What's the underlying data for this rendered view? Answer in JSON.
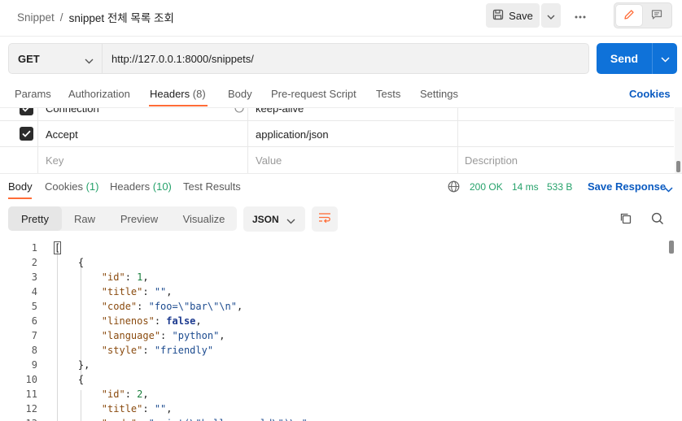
{
  "breadcrumb": {
    "parent": "Snippet",
    "separator": "/",
    "current": "snippet 전체 목록 조회"
  },
  "toolbar": {
    "save_label": "Save"
  },
  "request": {
    "method": "GET",
    "url": "http://127.0.0.1:8000/snippets/",
    "send_label": "Send"
  },
  "request_tabs": {
    "params": "Params",
    "authorization": "Authorization",
    "headers": "Headers",
    "headers_count": "(8)",
    "body": "Body",
    "prerequest": "Pre-request Script",
    "tests": "Tests",
    "settings": "Settings",
    "cookies": "Cookies"
  },
  "headers_table": {
    "rows": [
      {
        "key": "Connection",
        "value": "keep-alive",
        "checked": true
      },
      {
        "key": "Accept",
        "value": "application/json",
        "checked": true
      }
    ],
    "placeholders": {
      "key": "Key",
      "value": "Value",
      "description": "Description"
    }
  },
  "response_tabs": {
    "body": "Body",
    "cookies": "Cookies",
    "cookies_count": "(1)",
    "headers": "Headers",
    "headers_count": "(10)",
    "test_results": "Test Results"
  },
  "response_status": {
    "status": "200 OK",
    "time": "14 ms",
    "size": "533 B",
    "save_response": "Save Response"
  },
  "view_modes": {
    "pretty": "Pretty",
    "raw": "Raw",
    "preview": "Preview",
    "visualize": "Visualize",
    "active": "Pretty"
  },
  "format": "JSON",
  "code_lines": [
    {
      "n": "1",
      "parts": [
        [
          "p",
          "["
        ]
      ]
    },
    {
      "n": "2",
      "parts": [
        [
          "p",
          "    {"
        ]
      ]
    },
    {
      "n": "3",
      "parts": [
        [
          "p",
          "        "
        ],
        [
          "k",
          "\"id\""
        ],
        [
          "p",
          ": "
        ],
        [
          "n",
          "1"
        ],
        [
          "p",
          ","
        ]
      ]
    },
    {
      "n": "4",
      "parts": [
        [
          "p",
          "        "
        ],
        [
          "k",
          "\"title\""
        ],
        [
          "p",
          ": "
        ],
        [
          "s",
          "\"\""
        ],
        [
          "p",
          ","
        ]
      ]
    },
    {
      "n": "5",
      "parts": [
        [
          "p",
          "        "
        ],
        [
          "k",
          "\"code\""
        ],
        [
          "p",
          ": "
        ],
        [
          "s",
          "\"foo=\\\"bar\\\"\\n\""
        ],
        [
          "p",
          ","
        ]
      ]
    },
    {
      "n": "6",
      "parts": [
        [
          "p",
          "        "
        ],
        [
          "k",
          "\"linenos\""
        ],
        [
          "p",
          ": "
        ],
        [
          "b",
          "false"
        ],
        [
          "p",
          ","
        ]
      ]
    },
    {
      "n": "7",
      "parts": [
        [
          "p",
          "        "
        ],
        [
          "k",
          "\"language\""
        ],
        [
          "p",
          ": "
        ],
        [
          "s",
          "\"python\""
        ],
        [
          "p",
          ","
        ]
      ]
    },
    {
      "n": "8",
      "parts": [
        [
          "p",
          "        "
        ],
        [
          "k",
          "\"style\""
        ],
        [
          "p",
          ": "
        ],
        [
          "s",
          "\"friendly\""
        ]
      ]
    },
    {
      "n": "9",
      "parts": [
        [
          "p",
          "    },"
        ]
      ]
    },
    {
      "n": "10",
      "parts": [
        [
          "p",
          "    {"
        ]
      ]
    },
    {
      "n": "11",
      "parts": [
        [
          "p",
          "        "
        ],
        [
          "k",
          "\"id\""
        ],
        [
          "p",
          ": "
        ],
        [
          "n",
          "2"
        ],
        [
          "p",
          ","
        ]
      ]
    },
    {
      "n": "12",
      "parts": [
        [
          "p",
          "        "
        ],
        [
          "k",
          "\"title\""
        ],
        [
          "p",
          ": "
        ],
        [
          "s",
          "\"\""
        ],
        [
          "p",
          ","
        ]
      ]
    },
    {
      "n": "13",
      "parts": [
        [
          "p",
          "        "
        ],
        [
          "k",
          "\"code\""
        ],
        [
          "p",
          ": "
        ],
        [
          "s",
          "\"print(\\\"hello, world\\\")\\n\""
        ],
        [
          "p",
          ","
        ]
      ]
    }
  ],
  "colors": {
    "send": "#0f72d9",
    "tab_underline": "#ff6c37",
    "status_green": "#26a26b",
    "link_blue": "#0b5bc1",
    "edit_icon": "#ff6c37"
  },
  "icons": [
    "save-icon",
    "chevron-down-icon",
    "more-icon",
    "edit-icon",
    "comment-icon",
    "checkbox-icon",
    "globe-icon",
    "wrap-icon",
    "copy-icon",
    "search-icon"
  ]
}
